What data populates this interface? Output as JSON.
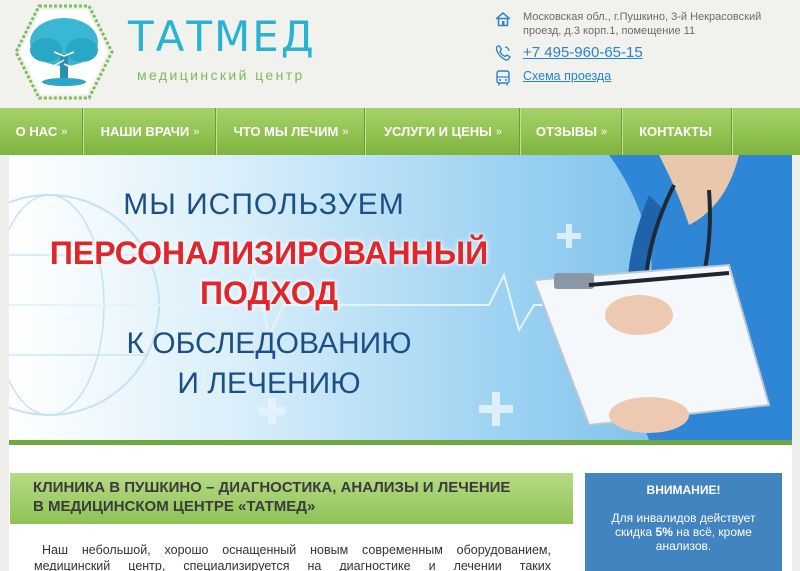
{
  "header": {
    "brand_name": "ТАТМЕД",
    "brand_sub": "медицинский центр",
    "address": "Московская обл., г.Пушкино, 3-й Некрасовский проезд, д.3 корп.1, помещение 11",
    "phone": "+7 495-960-65-15",
    "route_link": "Схема проезда"
  },
  "nav": {
    "items": [
      {
        "label": "О НАС",
        "arrow": "»"
      },
      {
        "label": "НАШИ ВРАЧИ",
        "arrow": "»"
      },
      {
        "label": "ЧТО МЫ ЛЕЧИМ",
        "arrow": "»"
      },
      {
        "label": "УСЛУГИ И ЦЕНЫ",
        "arrow": "»"
      },
      {
        "label": "ОТЗЫВЫ",
        "arrow": "»"
      },
      {
        "label": "КОНТАКТЫ",
        "arrow": ""
      }
    ]
  },
  "banner": {
    "line1": "МЫ ИСПОЛЬЗУЕМ",
    "line2": "ПЕРСОНАЛИЗИРОВАННЫЙ",
    "line3": "ПОДХОД",
    "line4": "К ОБСЛЕДОВАНИЮ",
    "line5": "И ЛЕЧЕНИЮ"
  },
  "main": {
    "headline_1": "КЛИНИКА В ПУШКИНО – ДИАГНОСТИКА, АНАЛИЗЫ И ЛЕЧЕНИЕ",
    "headline_2": "В МЕДИЦИНСКОМ ЦЕНТРЕ «ТАТМЕД»",
    "paragraph": "Наш небольшой, хорошо оснащенный новым современным оборудованием, медицинский центр, специализируется на диагностике и лечении таких распространенных заболеваний как:"
  },
  "notice": {
    "title": "ВНИМАНИЕ!",
    "text_before": "Для инвалидов действует скидка ",
    "discount": "5%",
    "text_after": " на всё, кроме анализов."
  },
  "colors": {
    "brand_blue": "#29b3d2",
    "brand_green": "#7dbb5a",
    "nav_green": "#8fc257",
    "accent_red": "#e0262b",
    "notice_blue": "#4284bf",
    "link_blue": "#2a83c9"
  },
  "icons": [
    "tree-logo-icon",
    "house-icon",
    "phone-icon",
    "bus-icon"
  ]
}
